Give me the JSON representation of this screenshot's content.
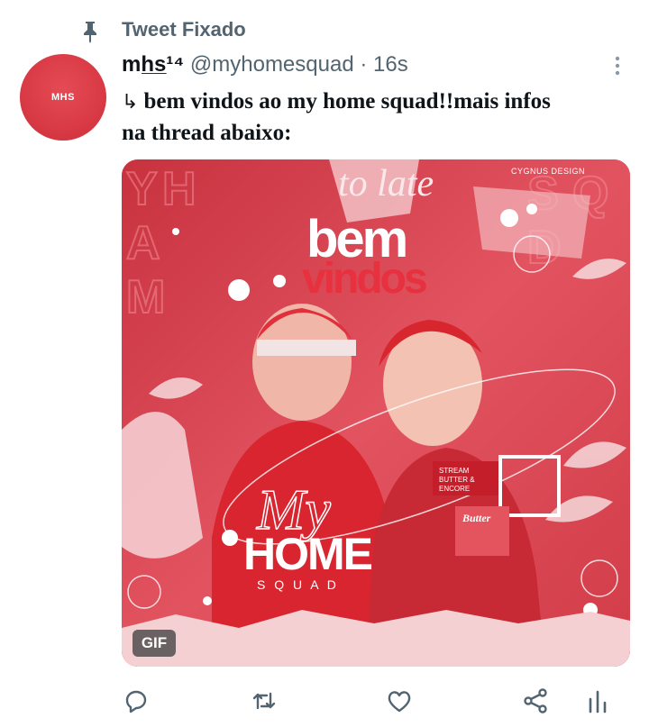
{
  "pinned": {
    "label": "Tweet Fixado",
    "icon": "pin-icon"
  },
  "author": {
    "avatar_text": "MHS",
    "display_name": "mh̲s̲¹⁴",
    "handle": "@myhomesquad",
    "separator": "·",
    "time": "16s"
  },
  "tweet": {
    "arrow": "↳",
    "text_line1": "bem vindos ao my home squad!!mais infos",
    "text_line2": "na thread abaixo:"
  },
  "media": {
    "watermark": "CYGNUS DESIGN",
    "script_text": "to late",
    "welcome_line1": "bem",
    "welcome_line2": "vindos",
    "my_text": "My",
    "home_text": "HOME",
    "squad_text": "S Q U A D",
    "stream_text_1": "STREAM",
    "stream_text_2": "BUTTER &",
    "stream_text_3": "ENCORE",
    "butter_text": "Butter",
    "gif_badge": "GIF"
  },
  "actions": [
    {
      "name": "reply-icon"
    },
    {
      "name": "retweet-icon"
    },
    {
      "name": "like-icon"
    },
    {
      "name": "share-icon"
    },
    {
      "name": "analytics-icon"
    }
  ],
  "colors": {
    "accent_red": "#d93a45",
    "muted": "#536471"
  }
}
